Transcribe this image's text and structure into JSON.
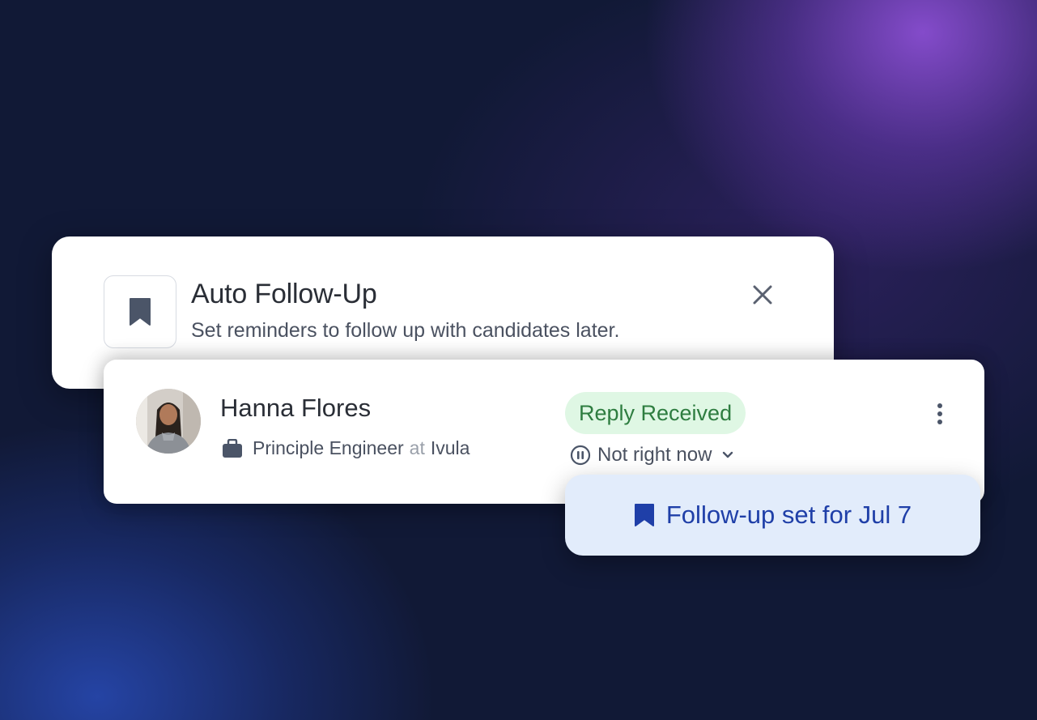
{
  "panel": {
    "title": "Auto Follow-Up",
    "subtitle": "Set reminders to follow up with candidates later.",
    "icon": "bookmark-icon",
    "close_icon": "close-icon"
  },
  "candidate": {
    "name": "Hanna Flores",
    "role": "Principle Engineer",
    "at_word": "at",
    "company": "Ivula",
    "role_icon": "briefcase-icon",
    "status_badge": "Reply Received",
    "status_option": "Not right now",
    "status_option_icon": "pause-circle-icon",
    "menu_icon": "more-vertical-icon"
  },
  "followup": {
    "label": "Follow-up set for Jul 7",
    "icon": "bookmark-icon"
  },
  "colors": {
    "background": "#111936",
    "accent_purple": "#8a4ed2",
    "accent_blue": "#2646aa",
    "badge_bg": "#dff7e4",
    "badge_text": "#2e7d40",
    "toast_bg": "#e2ecfb",
    "toast_text": "#1f3fa8",
    "icon_slate": "#4b5568"
  }
}
